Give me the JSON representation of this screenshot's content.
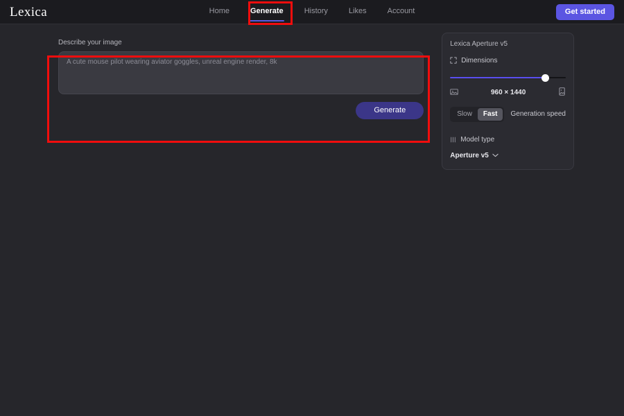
{
  "brand": {
    "logo": "Lexica"
  },
  "header": {
    "nav": [
      {
        "label": "Home",
        "active": false
      },
      {
        "label": "Generate",
        "active": true
      },
      {
        "label": "History",
        "active": false
      },
      {
        "label": "Likes",
        "active": false
      },
      {
        "label": "Account",
        "active": false
      }
    ],
    "cta_label": "Get started"
  },
  "prompt": {
    "label": "Describe your image",
    "placeholder": "A cute mouse pilot wearing aviator goggles, unreal engine render, 8k",
    "value": "",
    "generate_label": "Generate"
  },
  "panel": {
    "title": "Lexica Aperture v5",
    "dimensions": {
      "label": "Dimensions",
      "icon": "crop-corners-icon",
      "value": "960 × 1440",
      "slider_percent": 82,
      "landscape_icon": "landscape-image-icon",
      "portrait_icon": "portrait-image-icon"
    },
    "speed": {
      "label": "Generation speed",
      "options": [
        "Slow",
        "Fast"
      ],
      "selected": "Fast"
    },
    "model": {
      "label": "Model type",
      "icon": "sliders-icon",
      "selected": "Aperture v5"
    }
  },
  "colors": {
    "page_bg": "#26262b",
    "header_bg": "#1b1b1f",
    "panel_bg": "#2b2b31",
    "accent_cta": "#5b55e2",
    "accent_generate": "#3b3688",
    "slider_fill": "#5a4ef0",
    "annotation": "#f20d0d"
  }
}
